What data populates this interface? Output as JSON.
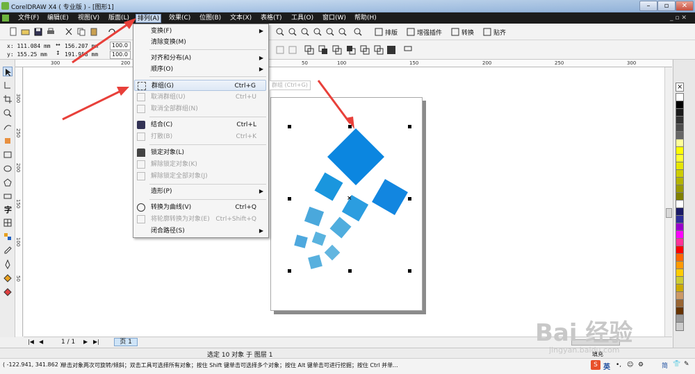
{
  "window": {
    "title": "CorelDRAW X4 ( 专业版 ) - [图形1]"
  },
  "menubar": {
    "items": [
      "文件(F)",
      "编辑(E)",
      "视图(V)",
      "版面(L)",
      "排列(A)",
      "效果(C)",
      "位图(B)",
      "文本(X)",
      "表格(T)",
      "工具(O)",
      "窗口(W)",
      "帮助(H)"
    ]
  },
  "toolbar": {
    "btn1": "排版",
    "btn2": "增强插件",
    "btn3": "转换",
    "btn4": "贴齐"
  },
  "propbar": {
    "x": "x: 111.084 mm",
    "y": "y: 155.25 mm",
    "w": "156.207 mm",
    "h": "191.958 mm",
    "sx": "100.0",
    "sy": "100.0"
  },
  "rulers": {
    "h": [
      "300",
      "200",
      "50",
      "100",
      "150",
      "200",
      "250",
      "300"
    ],
    "v": [
      "300",
      "250",
      "200",
      "150",
      "100",
      "50"
    ]
  },
  "arrange_menu": {
    "items": [
      {
        "label": "变换(F)",
        "shortcut": "",
        "submenu": true,
        "disabled": false
      },
      {
        "label": "清除变换(M)",
        "shortcut": "",
        "submenu": false,
        "disabled": false
      },
      {
        "label": "对齐和分布(A)",
        "shortcut": "",
        "submenu": true,
        "disabled": false
      },
      {
        "label": "顺序(O)",
        "shortcut": "",
        "submenu": true,
        "disabled": false
      },
      {
        "label": "群组(G)",
        "shortcut": "Ctrl+G",
        "submenu": false,
        "disabled": false
      },
      {
        "label": "取消群组(U)",
        "shortcut": "Ctrl+U",
        "submenu": false,
        "disabled": true
      },
      {
        "label": "取消全部群组(N)",
        "shortcut": "",
        "submenu": false,
        "disabled": true
      },
      {
        "label": "结合(C)",
        "shortcut": "Ctrl+L",
        "submenu": false,
        "disabled": false
      },
      {
        "label": "打散(B)",
        "shortcut": "Ctrl+K",
        "submenu": false,
        "disabled": true
      },
      {
        "label": "锁定对象(L)",
        "shortcut": "",
        "submenu": false,
        "disabled": false
      },
      {
        "label": "解除锁定对象(K)",
        "shortcut": "",
        "submenu": false,
        "disabled": true
      },
      {
        "label": "解除锁定全部对象(J)",
        "shortcut": "",
        "submenu": false,
        "disabled": true
      },
      {
        "label": "造形(P)",
        "shortcut": "",
        "submenu": true,
        "disabled": false
      },
      {
        "label": "转换为曲线(V)",
        "shortcut": "Ctrl+Q",
        "submenu": false,
        "disabled": false
      },
      {
        "label": "将轮廓转换为对象(E)",
        "shortcut": "Ctrl+Shift+Q",
        "submenu": false,
        "disabled": true
      },
      {
        "label": "闭合路径(S)",
        "shortcut": "",
        "submenu": true,
        "disabled": false
      }
    ],
    "tooltip": "群组 (Ctrl+G)"
  },
  "page_nav": {
    "counter": "1 / 1",
    "tab": "页 1"
  },
  "status": {
    "selection": "选定 10 对象 于 图层 1",
    "coords": "( -122.941, 341.862 )",
    "hint": "单击对象两次可旋转/倾斜；双击工具可选择所有对象；按住 Shift 键单击可选择多个对象；按住 Alt 键单击可进行挖掘；按住 Ctrl 并单...",
    "fill_label": "填充"
  },
  "tray": {
    "ime": "英"
  },
  "watermark": {
    "logo": "Bai 经验",
    "url": "jingyan.baidu.com"
  },
  "colors": {
    "accent": "#1f8de0",
    "menu_bg": "#1c1c1c",
    "highlight": "#dde8f5",
    "arrow": "#e8403a"
  },
  "palette_colors": [
    "#ffffff",
    "#000000",
    "#1a1a1a",
    "#333333",
    "#4d4d4d",
    "#666666",
    "#ffff99",
    "#ffff00",
    "#ffff33",
    "#e6e600",
    "#cccc00",
    "#b3b300",
    "#999900",
    "#808000",
    "#ffffff",
    "#1a1a66",
    "#2e2e99",
    "#9900cc",
    "#ff00ff",
    "#ff3399",
    "#ff0000",
    "#ff6600",
    "#ff9900",
    "#ffcc00",
    "#cccc33",
    "#ccaa00",
    "#cc9966",
    "#996633",
    "#663300",
    "#999999",
    "#cccccc",
    "#b3b3b3",
    "#d9d9d9",
    "#e6e6e6"
  ]
}
